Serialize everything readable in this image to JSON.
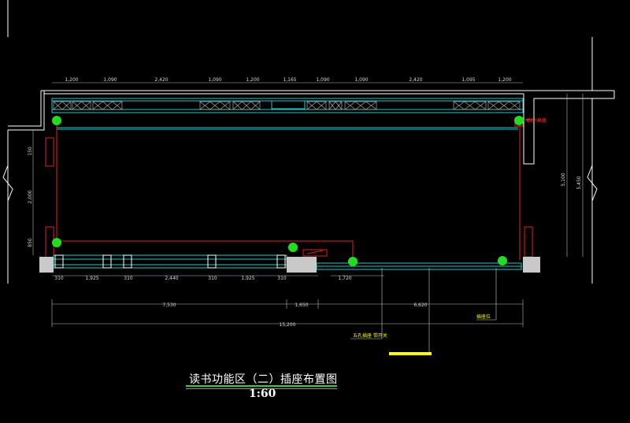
{
  "top_dims": [
    "1,200",
    "1,090",
    "2,420",
    "1,090",
    "1,200",
    "1,165",
    "1,090",
    "1,090",
    "2,420",
    "1,095",
    "1,200"
  ],
  "bottom_dims": [
    "310",
    "1,925",
    "310",
    "2,440",
    "310",
    "1,925",
    "310",
    "1,720"
  ],
  "overall_dims": {
    "a": "7,530",
    "b": "1,650",
    "c": "6,620",
    "total": "15,200"
  },
  "left_dims": [
    "150",
    "2,000",
    "850"
  ],
  "right_dims": [
    "5,100",
    "5,450"
  ],
  "labels": {
    "label_red": "插座 高度",
    "leader_1": "插座位",
    "leader_2": "五孔插座 带开关"
  },
  "title": {
    "main": "读书功能区（二）插座布置图",
    "scale": "1:60"
  },
  "colors": {
    "wall": "#ffffff",
    "window": "#1fc8c8",
    "wiring": "#e02020",
    "socket": "#22dd22",
    "title_underline": "#2fd62f",
    "leader": "#ffff00"
  }
}
